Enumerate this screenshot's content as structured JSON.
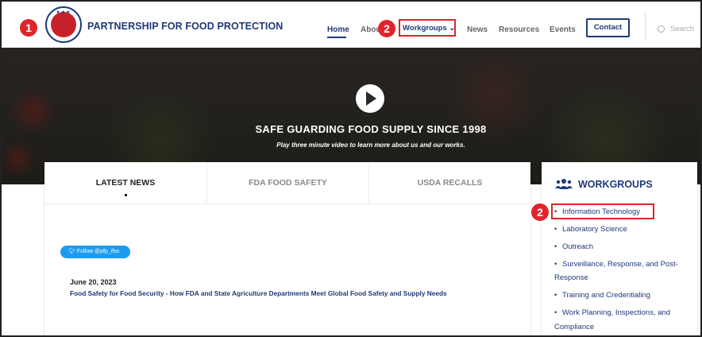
{
  "header": {
    "brand": "PARTNERSHIP FOR FOOD PROTECTION",
    "logo_stars": "★★★",
    "nav": {
      "home": "Home",
      "about": "About",
      "workgroups": "Workgroups ⌄",
      "news": "News",
      "resources": "Resources",
      "events": "Events",
      "contact": "Contact"
    },
    "search_placeholder": "Search"
  },
  "annotations": {
    "badge1": "1",
    "badge2_nav": "2",
    "badge2_sidebar": "2",
    "color": "#e0242b"
  },
  "hero": {
    "title": "SAFE GUARDING FOOD SUPPLY SINCE 1998",
    "subtitle": "Play three minute video to learn more about us and our works."
  },
  "tabs": [
    "LATEST NEWS",
    "FDA FOOD SAFETY",
    "USDA RECALLS"
  ],
  "news": {
    "follow_label": "Follow @pfp_ifss",
    "date": "June 20, 2023",
    "headline": "Food Safety for Food Security - How FDA and State Agriculture Departments Meet Global Food Safety and Supply Needs"
  },
  "sidebar": {
    "title": "WORKGROUPS",
    "items": [
      "Information Technology",
      "Laboratory Science",
      "Outreach",
      "Surveillance, Response, and Post-",
      "Response",
      "Training and Credentialing",
      "Work Planning, Inspections, and",
      "Compliance"
    ]
  },
  "colors": {
    "brand_navy": "#1e3a78",
    "highlight_red": "#d9262c"
  }
}
